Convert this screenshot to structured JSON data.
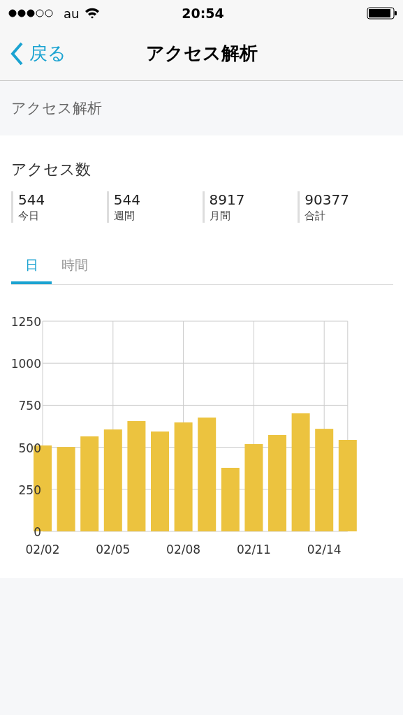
{
  "status_bar": {
    "carrier": "au",
    "time": "20:54"
  },
  "nav_bar": {
    "back": "戻る",
    "title": "アクセス解析"
  },
  "section_header": "アクセス解析",
  "card": {
    "title": "アクセス数",
    "stats": [
      {
        "value": "544",
        "label": "今日"
      },
      {
        "value": "544",
        "label": "週間"
      },
      {
        "value": "8917",
        "label": "月間"
      },
      {
        "value": "90377",
        "label": "合計"
      }
    ],
    "tabs": [
      {
        "label": "日",
        "selected": true
      },
      {
        "label": "時間",
        "selected": false
      }
    ],
    "chart_data": {
      "type": "bar",
      "categories": [
        "02/02",
        null,
        null,
        "02/05",
        null,
        null,
        "02/08",
        null,
        null,
        "02/11",
        null,
        null,
        "02/14",
        null
      ],
      "values": [
        511,
        502,
        565,
        606,
        656,
        594,
        648,
        677,
        378,
        519,
        573,
        702,
        610,
        544
      ],
      "ylim": [
        0,
        1250
      ],
      "yticks": [
        0,
        250,
        500,
        750,
        1000,
        1250
      ],
      "grid": true
    }
  }
}
